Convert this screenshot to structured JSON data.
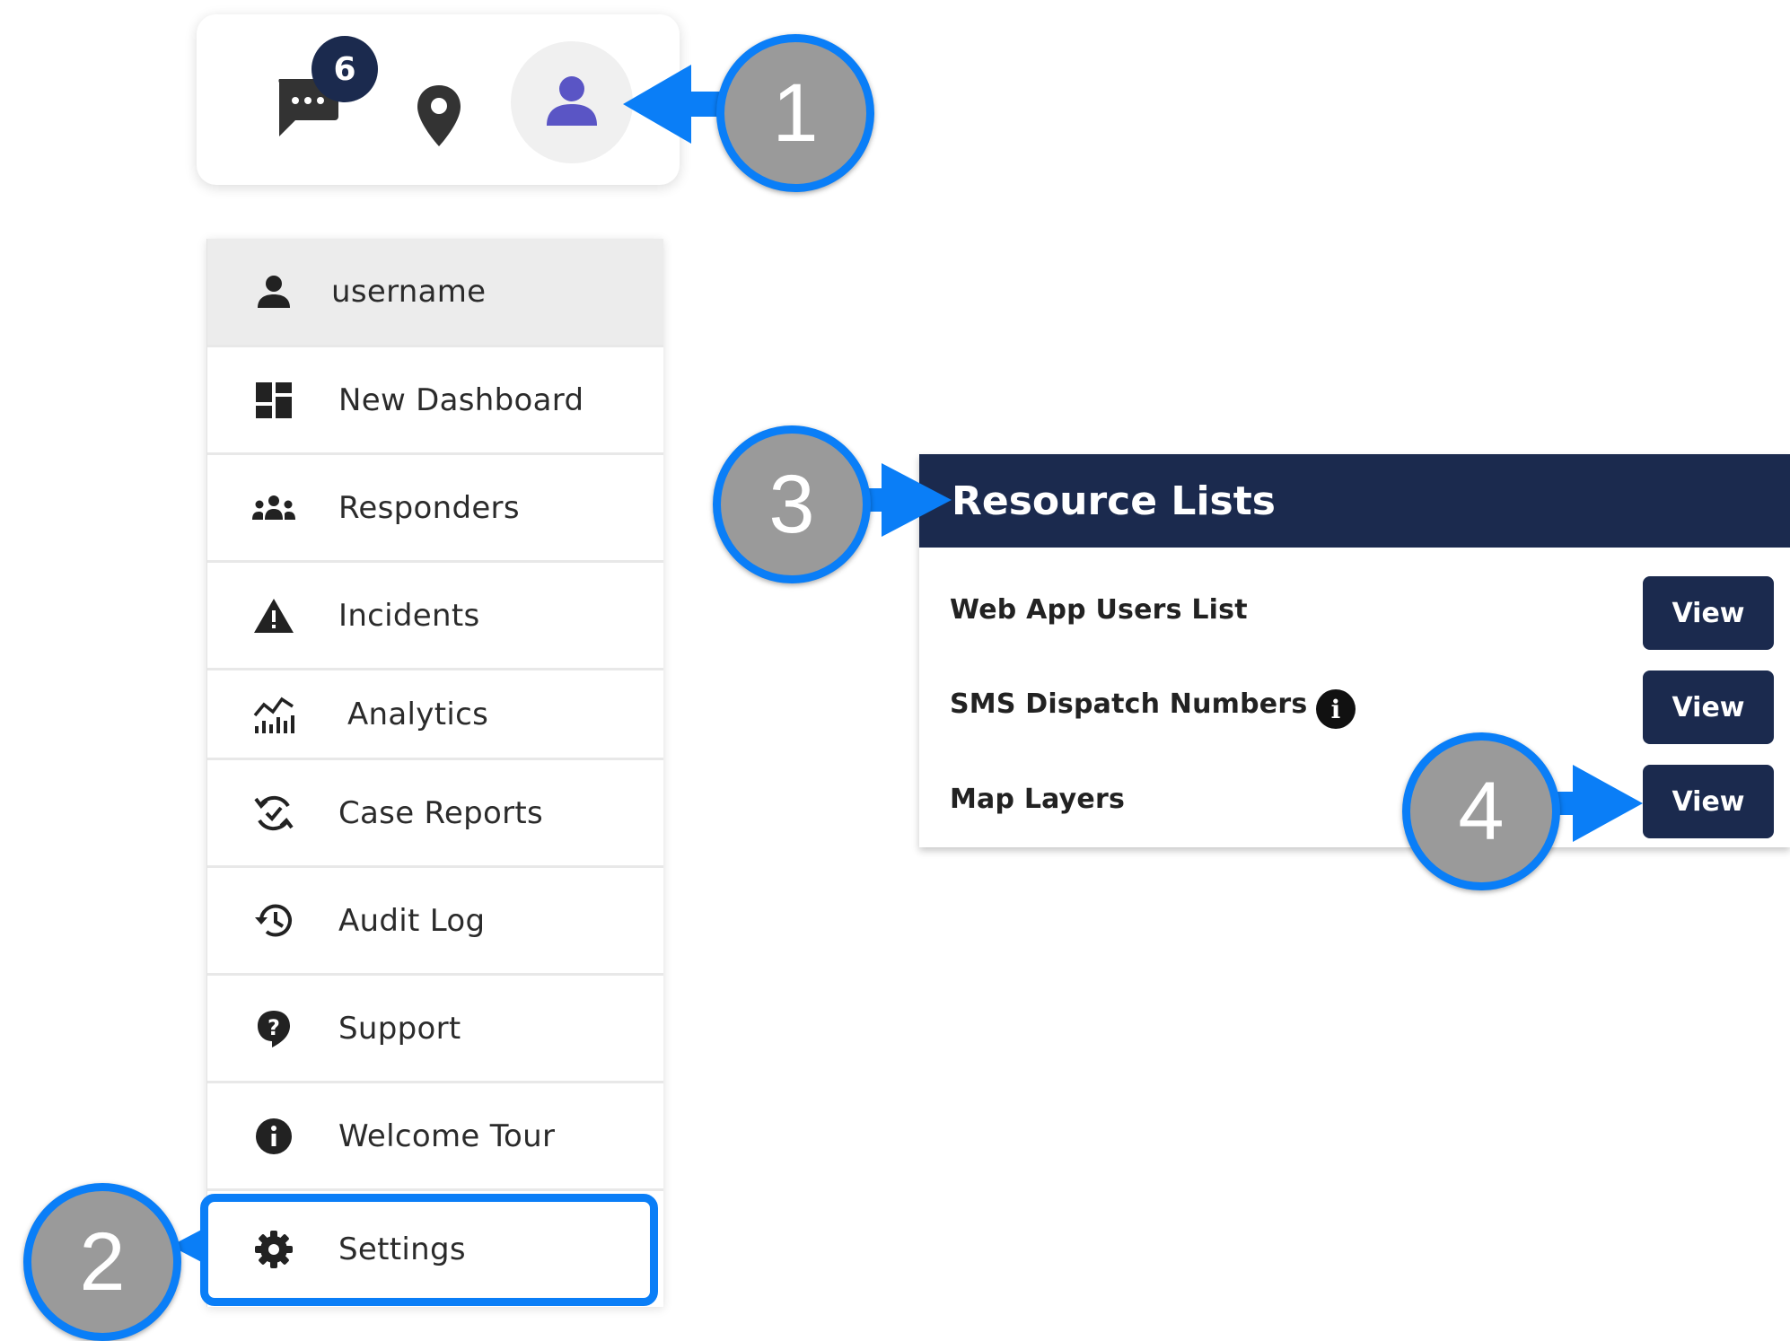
{
  "toolbar": {
    "chat_badge_count": "6",
    "icons": [
      "chat-icon",
      "map-pin-icon",
      "person-icon"
    ]
  },
  "menu": {
    "items": [
      {
        "label": "username",
        "icon": "person-icon"
      },
      {
        "label": "New Dashboard",
        "icon": "dashboard-icon"
      },
      {
        "label": "Responders",
        "icon": "group-icon"
      },
      {
        "label": "Incidents",
        "icon": "warning-icon"
      },
      {
        "label": "Analytics",
        "icon": "analytics-icon"
      },
      {
        "label": "Case Reports",
        "icon": "sync-check-icon"
      },
      {
        "label": "Audit Log",
        "icon": "history-icon"
      },
      {
        "label": "Support",
        "icon": "help-icon"
      },
      {
        "label": "Welcome Tour",
        "icon": "info-icon"
      },
      {
        "label": "Settings",
        "icon": "gear-icon"
      }
    ]
  },
  "resource_panel": {
    "title": "Resource Lists",
    "rows": [
      {
        "label": "Web App Users List",
        "button": "View"
      },
      {
        "label": "SMS Dispatch Numbers",
        "button": "View",
        "info_icon": "i"
      },
      {
        "label": "Map Layers",
        "button": "View"
      }
    ]
  },
  "callouts": [
    "1",
    "2",
    "3",
    "4"
  ],
  "colors": {
    "navy": "#1b2a4e",
    "callout_blue": "#0a7ef7",
    "callout_gray": "#9a9a9a",
    "avatar_purple": "#5a55c5"
  }
}
